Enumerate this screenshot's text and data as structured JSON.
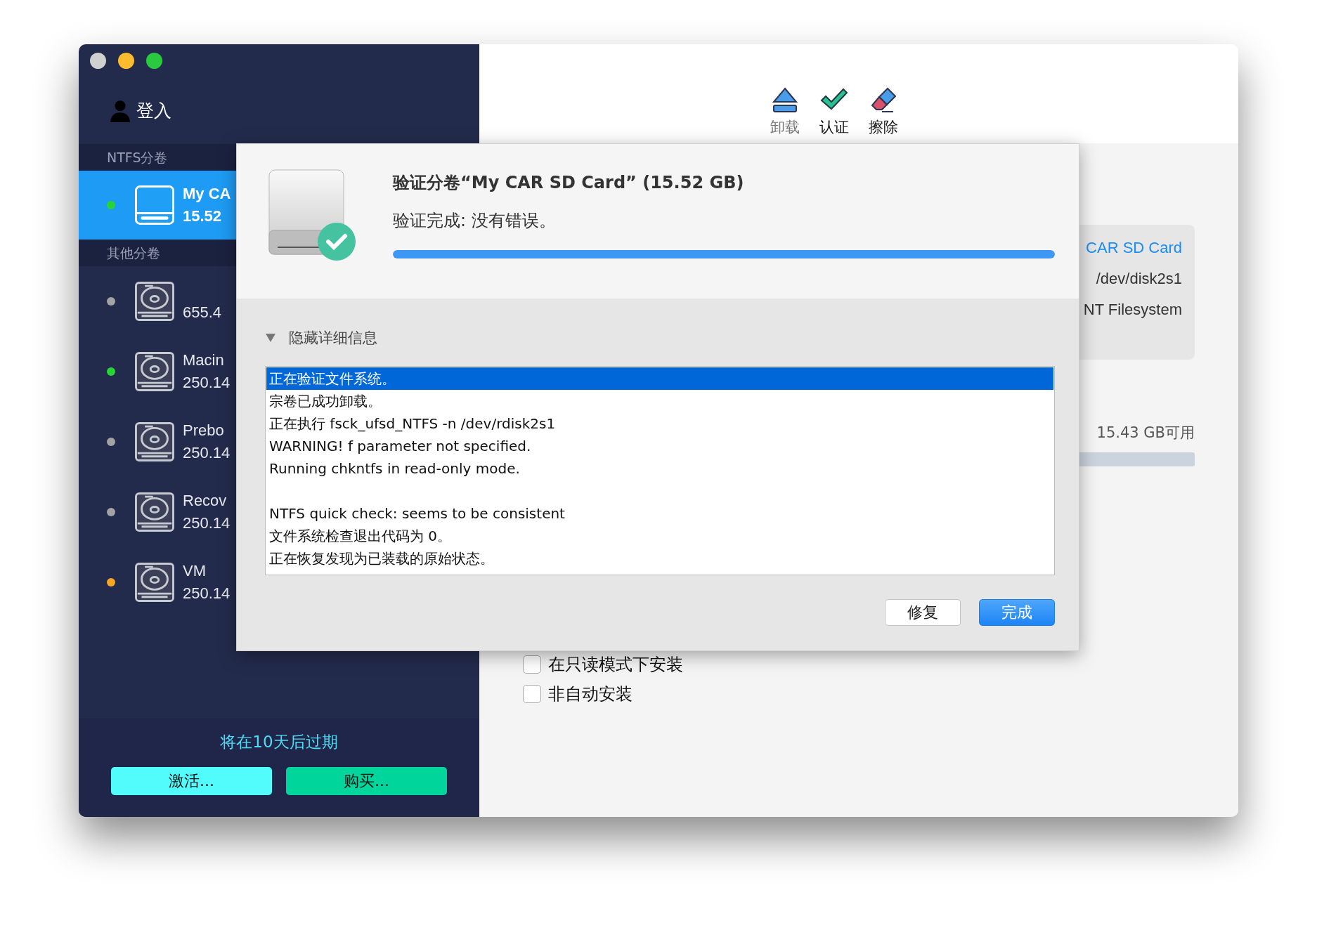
{
  "sidebar": {
    "user": "登入",
    "sections": [
      {
        "title": "NTFS分卷",
        "items": [
          {
            "kind": "removable",
            "name": "My CA",
            "size": "15.52",
            "color": "#27d436",
            "selected": true
          }
        ]
      },
      {
        "title": "其他分卷",
        "items": [
          {
            "kind": "disk",
            "size": "655.4",
            "color": "#a3a3a3",
            "selected": false
          },
          {
            "kind": "disk",
            "name": "Macin",
            "size": "250.14",
            "color": "#27d436",
            "selected": false
          },
          {
            "kind": "disk",
            "name": "Prebo",
            "size": "250.14",
            "color": "#a3a3a3",
            "selected": false
          },
          {
            "kind": "disk",
            "name": "Recov",
            "size": "250.14",
            "color": "#a3a3a3",
            "selected": false
          },
          {
            "kind": "disk",
            "name": "VM",
            "size": "250.14",
            "color": "#f5a623",
            "selected": false
          }
        ]
      }
    ],
    "expiry": "将在10天后过期",
    "buttons": [
      {
        "kind": "activate",
        "label": "激活..."
      },
      {
        "kind": "buy",
        "label": "购买..."
      }
    ]
  },
  "toolbar": [
    {
      "kind": "eject",
      "label": "卸载",
      "disabled": true
    },
    {
      "kind": "verify",
      "label": "认证",
      "disabled": false
    },
    {
      "kind": "erase",
      "label": "擦除",
      "disabled": false
    }
  ],
  "info_card": [
    {
      "kind": "name",
      "text": "CAR SD Card"
    },
    {
      "kind": "value",
      "text": "/dev/disk2s1"
    },
    {
      "kind": "value",
      "text": "NT Filesystem"
    }
  ],
  "storage": {
    "available": "15.43 GB可用"
  },
  "options": [
    {
      "label": "在只读模式下安装",
      "checked": false
    },
    {
      "label": "非自动安装",
      "checked": false
    }
  ],
  "dialog": {
    "title": "验证分卷“My CAR SD Card” (15.52 GB)",
    "status": "验证完成: 没有错误。",
    "progress": {
      "level": 1
    },
    "details_toggle": {
      "label": "隐藏详细信息",
      "expanded": true
    },
    "log": [
      {
        "kind": "line",
        "text": "正在验证文件系统。",
        "selected": true
      },
      {
        "kind": "line",
        "text": "宗卷已成功卸载。",
        "selected": false
      },
      {
        "kind": "line",
        "text": "正在执行 fsck_ufsd_NTFS -n /dev/rdisk2s1",
        "selected": false
      },
      {
        "kind": "line",
        "text": "WARNING!  f parameter not specified.",
        "selected": false
      },
      {
        "kind": "line",
        "text": "Running chkntfs in read-only mode.",
        "selected": false
      },
      {
        "kind": "blank"
      },
      {
        "kind": "line",
        "text": "NTFS quick check: seems to be consistent",
        "selected": false
      },
      {
        "kind": "line",
        "text": "文件系统检查退出代码为 0。",
        "selected": false
      },
      {
        "kind": "line",
        "text": "正在恢复发现为已装载的原始状态。",
        "selected": false
      }
    ],
    "buttons": [
      {
        "label": "修复",
        "default": false
      },
      {
        "label": "完成",
        "default": true
      }
    ]
  }
}
